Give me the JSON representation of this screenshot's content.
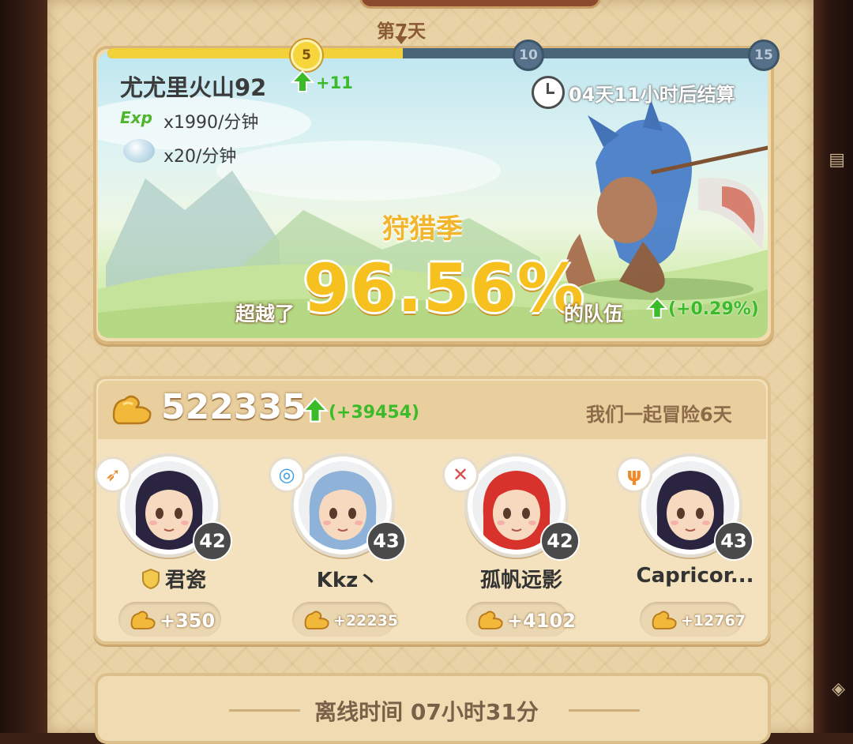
{
  "season": {
    "day_label": "第7天",
    "progress": {
      "milestones": [
        "5",
        "10",
        "15"
      ],
      "current_fraction": 0.45,
      "active_milestone": "5"
    },
    "location": "尤尤里火山92",
    "location_delta": "+11",
    "exp_badge": "Exp",
    "exp_rate": "x1990/分钟",
    "shell_rate": "x20/分钟",
    "settle_timer": "04天11小时后结算",
    "title": "狩猎季",
    "pct_prefix": "超越了",
    "percentile": "96.56%",
    "pct_suffix": "的队伍",
    "pct_delta": "(+0.29%)"
  },
  "team": {
    "power": "522335",
    "power_delta": "(+39454)",
    "adventure_days": "我们一起冒险6天",
    "members": [
      {
        "name": "君瓷",
        "level": "42",
        "contribution": "+350",
        "class_icon": "flame-claw-icon",
        "class_color": "#f08a2a",
        "guild_badge": true,
        "hair": "#2b2440"
      },
      {
        "name": "Kkz丶",
        "level": "43",
        "contribution": "+22235",
        "class_icon": "water-swirl-icon",
        "class_color": "#3a9bdc",
        "guild_badge": false,
        "hair": "#8fb3d8"
      },
      {
        "name": "孤帆远影",
        "level": "42",
        "contribution": "+4102",
        "class_icon": "crossed-blades-icon",
        "class_color": "#d94a4a",
        "guild_badge": false,
        "hair": "#d8322c"
      },
      {
        "name": "Capricor...",
        "level": "43",
        "contribution": "+12767",
        "class_icon": "trident-icon",
        "class_color": "#f08a2a",
        "guild_badge": false,
        "hair": "#2b2440"
      }
    ]
  },
  "offline": {
    "label": "离线时间 07小时31分"
  },
  "colors": {
    "parchment": "#e9d3a6",
    "gold": "#f6c11f",
    "green_up": "#3cbb2a",
    "progress_fill": "#f3d13a",
    "progress_track": "#4a6478"
  }
}
